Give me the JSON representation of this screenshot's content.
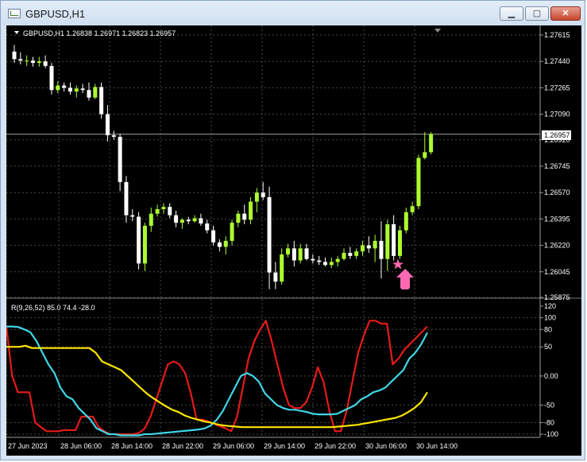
{
  "window": {
    "title": "GBPUSD,H1",
    "min_label": "▁",
    "max_label": "▢",
    "close_label": "✕"
  },
  "price_pane": {
    "header": "GBPUSD,H1  1.26838 1.26971 1.26823 1.26957",
    "current_price": "1.26957",
    "price_ticks": [
      "1.27615",
      "1.27440",
      "1.27265",
      "1.27090",
      "1.26920",
      "1.26745",
      "1.26570",
      "1.26395",
      "1.26220",
      "1.26045",
      "1.25875"
    ],
    "signal": {
      "star_icon": "star-icon",
      "arrow_icon": "up-arrow-icon",
      "color": "#ff69b4"
    }
  },
  "indicator_pane": {
    "header": "R(9,26,52) 85.0 74.4 -28.0",
    "ticks": [
      "120",
      "100",
      "80",
      "50",
      "0.00",
      "-50",
      "-80",
      "-100"
    ]
  },
  "x_axis": {
    "labels": [
      "27 Jun 2023",
      "28 Jun 06:00",
      "28 Jun 14:00",
      "28 Jun 22:00",
      "29 Jun 06:00",
      "29 Jun 14:00",
      "29 Jun 22:00",
      "30 Jun 06:00",
      "30 Jun 14:00"
    ]
  },
  "colors": {
    "background": "#000000",
    "bull_candle": "#adff2f",
    "bear_candle": "#ffffff",
    "grid": "#4a4a4a",
    "fast_line": "#e41b17",
    "mid_line": "#3fd6e6",
    "slow_line": "#ffe500"
  },
  "chart_data": [
    {
      "type": "candlestick",
      "title": "GBPUSD,H1",
      "ylim": [
        1.2587,
        1.2771
      ],
      "candles": [
        [
          1.27505,
          1.2755,
          1.2743,
          1.27455
        ],
        [
          1.27455,
          1.275,
          1.2742,
          1.27445
        ],
        [
          1.27445,
          1.2748,
          1.2741,
          1.27445
        ],
        [
          1.27445,
          1.2747,
          1.27405,
          1.2743
        ],
        [
          1.2743,
          1.2747,
          1.27405,
          1.2744
        ],
        [
          1.2744,
          1.2748,
          1.27395,
          1.2741
        ],
        [
          1.2741,
          1.2743,
          1.2722,
          1.2725
        ],
        [
          1.2725,
          1.2731,
          1.2723,
          1.2728
        ],
        [
          1.2728,
          1.273,
          1.2724,
          1.27265
        ],
        [
          1.27265,
          1.273,
          1.2722,
          1.2724
        ],
        [
          1.2724,
          1.2728,
          1.272,
          1.2726
        ],
        [
          1.2726,
          1.2729,
          1.2723,
          1.2725
        ],
        [
          1.2725,
          1.273,
          1.2718,
          1.272
        ],
        [
          1.272,
          1.2729,
          1.2719,
          1.2727
        ],
        [
          1.2727,
          1.273,
          1.2706,
          1.2709
        ],
        [
          1.2709,
          1.2715,
          1.2691,
          1.2695
        ],
        [
          1.2695,
          1.2698,
          1.2692,
          1.2694
        ],
        [
          1.2694,
          1.2696,
          1.2658,
          1.2664
        ],
        [
          1.2664,
          1.2668,
          1.2637,
          1.2642
        ],
        [
          1.2642,
          1.2646,
          1.2638,
          1.2641
        ],
        [
          1.2641,
          1.2644,
          1.2606,
          1.261
        ],
        [
          1.261,
          1.2637,
          1.2605,
          1.2635
        ],
        [
          1.2635,
          1.2647,
          1.2631,
          1.2643
        ],
        [
          1.2643,
          1.2649,
          1.2641,
          1.2646
        ],
        [
          1.2646,
          1.265,
          1.2643,
          1.26475
        ],
        [
          1.26475,
          1.265,
          1.264,
          1.2642
        ],
        [
          1.2642,
          1.2645,
          1.2634,
          1.2637
        ],
        [
          1.2637,
          1.264,
          1.2633,
          1.2639
        ],
        [
          1.2639,
          1.2641,
          1.2636,
          1.2638
        ],
        [
          1.2638,
          1.2642,
          1.2637,
          1.264
        ],
        [
          1.264,
          1.2643,
          1.2635,
          1.26365
        ],
        [
          1.26365,
          1.2639,
          1.263,
          1.2632
        ],
        [
          1.2632,
          1.2635,
          1.2622,
          1.2624
        ],
        [
          1.2624,
          1.2626,
          1.2618,
          1.2621
        ],
        [
          1.2621,
          1.2628,
          1.2616,
          1.2625
        ],
        [
          1.2625,
          1.2639,
          1.2622,
          1.2637
        ],
        [
          1.2637,
          1.2645,
          1.2634,
          1.2643
        ],
        [
          1.2643,
          1.2649,
          1.2636,
          1.2639
        ],
        [
          1.2639,
          1.2654,
          1.2636,
          1.2651
        ],
        [
          1.2651,
          1.266,
          1.2644,
          1.2657
        ],
        [
          1.2657,
          1.2664,
          1.2652,
          1.2654
        ],
        [
          1.2654,
          1.2661,
          1.2593,
          1.2604
        ],
        [
          1.2604,
          1.2611,
          1.2593,
          1.2598
        ],
        [
          1.2598,
          1.262,
          1.2596,
          1.2616
        ],
        [
          1.2616,
          1.2623,
          1.2614,
          1.262
        ],
        [
          1.262,
          1.2625,
          1.2608,
          1.2612
        ],
        [
          1.2612,
          1.2623,
          1.261,
          1.262
        ],
        [
          1.262,
          1.2623,
          1.2612,
          1.2613
        ],
        [
          1.2613,
          1.2616,
          1.261,
          1.2612
        ],
        [
          1.2612,
          1.2615,
          1.2609,
          1.2611
        ],
        [
          1.2611,
          1.2614,
          1.2608,
          1.2609
        ],
        [
          1.2609,
          1.2614,
          1.2607,
          1.2611
        ],
        [
          1.2611,
          1.2615,
          1.2608,
          1.2613
        ],
        [
          1.2613,
          1.262,
          1.2612,
          1.2617
        ],
        [
          1.2617,
          1.2621,
          1.2613,
          1.2615
        ],
        [
          1.2615,
          1.262,
          1.2613,
          1.2618
        ],
        [
          1.2618,
          1.2625,
          1.2615,
          1.2622
        ],
        [
          1.2622,
          1.2628,
          1.2617,
          1.262
        ],
        [
          1.262,
          1.2629,
          1.2611,
          1.2625
        ],
        [
          1.2625,
          1.2638,
          1.26,
          1.2613
        ],
        [
          1.2613,
          1.2639,
          1.2605,
          1.2636
        ],
        [
          1.2636,
          1.2642,
          1.2612,
          1.2615
        ],
        [
          1.2615,
          1.2635,
          1.2613,
          1.2632
        ],
        [
          1.2632,
          1.2647,
          1.263,
          1.2644
        ],
        [
          1.2644,
          1.2651,
          1.2642,
          1.2648
        ],
        [
          1.2648,
          1.2682,
          1.2646,
          1.268
        ],
        [
          1.268,
          1.26971,
          1.2679,
          1.26838
        ],
        [
          1.26838,
          1.26971,
          1.26823,
          1.26957
        ]
      ]
    },
    {
      "type": "line",
      "title": "R(9,26,52)",
      "ylim": [
        -100,
        120
      ],
      "series": [
        {
          "values": [
            85,
            0,
            -28,
            -28,
            -28,
            -80,
            -88,
            -95,
            -95,
            -95,
            -93,
            -93,
            -93,
            -70,
            -70,
            -70,
            -88,
            -95,
            -100,
            -100,
            -100,
            -100,
            -100,
            -98,
            -90,
            -70,
            -40,
            -10,
            20,
            25,
            20,
            5,
            -30,
            -75,
            -75,
            -78,
            -82,
            -86,
            -90,
            -95,
            -70,
            -20,
            30,
            60,
            80,
            95,
            60,
            20,
            -20,
            -50,
            -55,
            -55,
            -45,
            -20,
            15,
            -10,
            -60,
            -95,
            -95,
            -60,
            -10,
            40,
            70,
            95,
            95,
            90,
            90,
            20,
            30,
            45,
            55,
            65,
            75,
            85
          ]
        },
        {
          "values": [
            85,
            85,
            84,
            80,
            75,
            60,
            40,
            20,
            5,
            -20,
            -35,
            -40,
            -55,
            -65,
            -75,
            -90,
            -95,
            -100,
            -100,
            -102,
            -102,
            -102,
            -102,
            -100,
            -100,
            -99,
            -98,
            -97,
            -96,
            -95,
            -94,
            -93,
            -92,
            -90,
            -85,
            -75,
            -60,
            -40,
            -20,
            0,
            5,
            0,
            -10,
            -30,
            -40,
            -50,
            -55,
            -58,
            -58,
            -60,
            -62,
            -65,
            -66,
            -66,
            -66,
            -65,
            -60,
            -55,
            -50,
            -40,
            -35,
            -28,
            -25,
            -20,
            -10,
            0,
            10,
            30,
            40,
            55,
            74.4
          ]
        },
        {
          "values": [
            50,
            50,
            50,
            52,
            48,
            48,
            48,
            48,
            48,
            48,
            48,
            48,
            48,
            48,
            40,
            25,
            20,
            15,
            10,
            0,
            -10,
            -20,
            -30,
            -38,
            -45,
            -52,
            -58,
            -62,
            -68,
            -72,
            -75,
            -78,
            -80,
            -83,
            -85,
            -86,
            -87,
            -88,
            -88,
            -88,
            -88,
            -88,
            -88,
            -88,
            -88,
            -88,
            -88,
            -88,
            -88,
            -88,
            -88,
            -88,
            -87,
            -86,
            -85,
            -84,
            -82,
            -80,
            -78,
            -76,
            -74,
            -72,
            -68,
            -62,
            -55,
            -45,
            -28
          ]
        }
      ]
    }
  ]
}
